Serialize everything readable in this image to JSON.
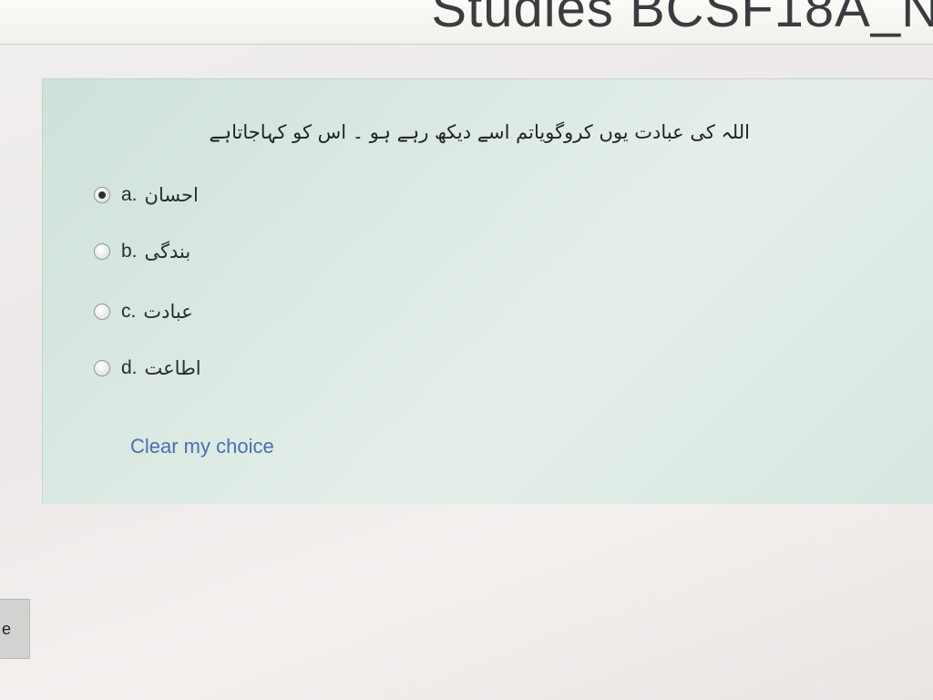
{
  "header": {
    "title": "Studies BCSF18A_N"
  },
  "question": {
    "text": "اللہ کی عبادت یوں کروگویاتم اسے دیکھ رہے ہو ۔ اس کو کہاجاتاہے",
    "answers": [
      {
        "letter": "a.",
        "text": "احسان",
        "checked": true
      },
      {
        "letter": "b.",
        "text": "بندگی",
        "checked": false
      },
      {
        "letter": "c.",
        "text": "عبادت",
        "checked": false
      },
      {
        "letter": "d.",
        "text": "اطاعت",
        "checked": false
      }
    ],
    "clear_label": "Clear my choice"
  },
  "side_tab": {
    "label": "e"
  }
}
